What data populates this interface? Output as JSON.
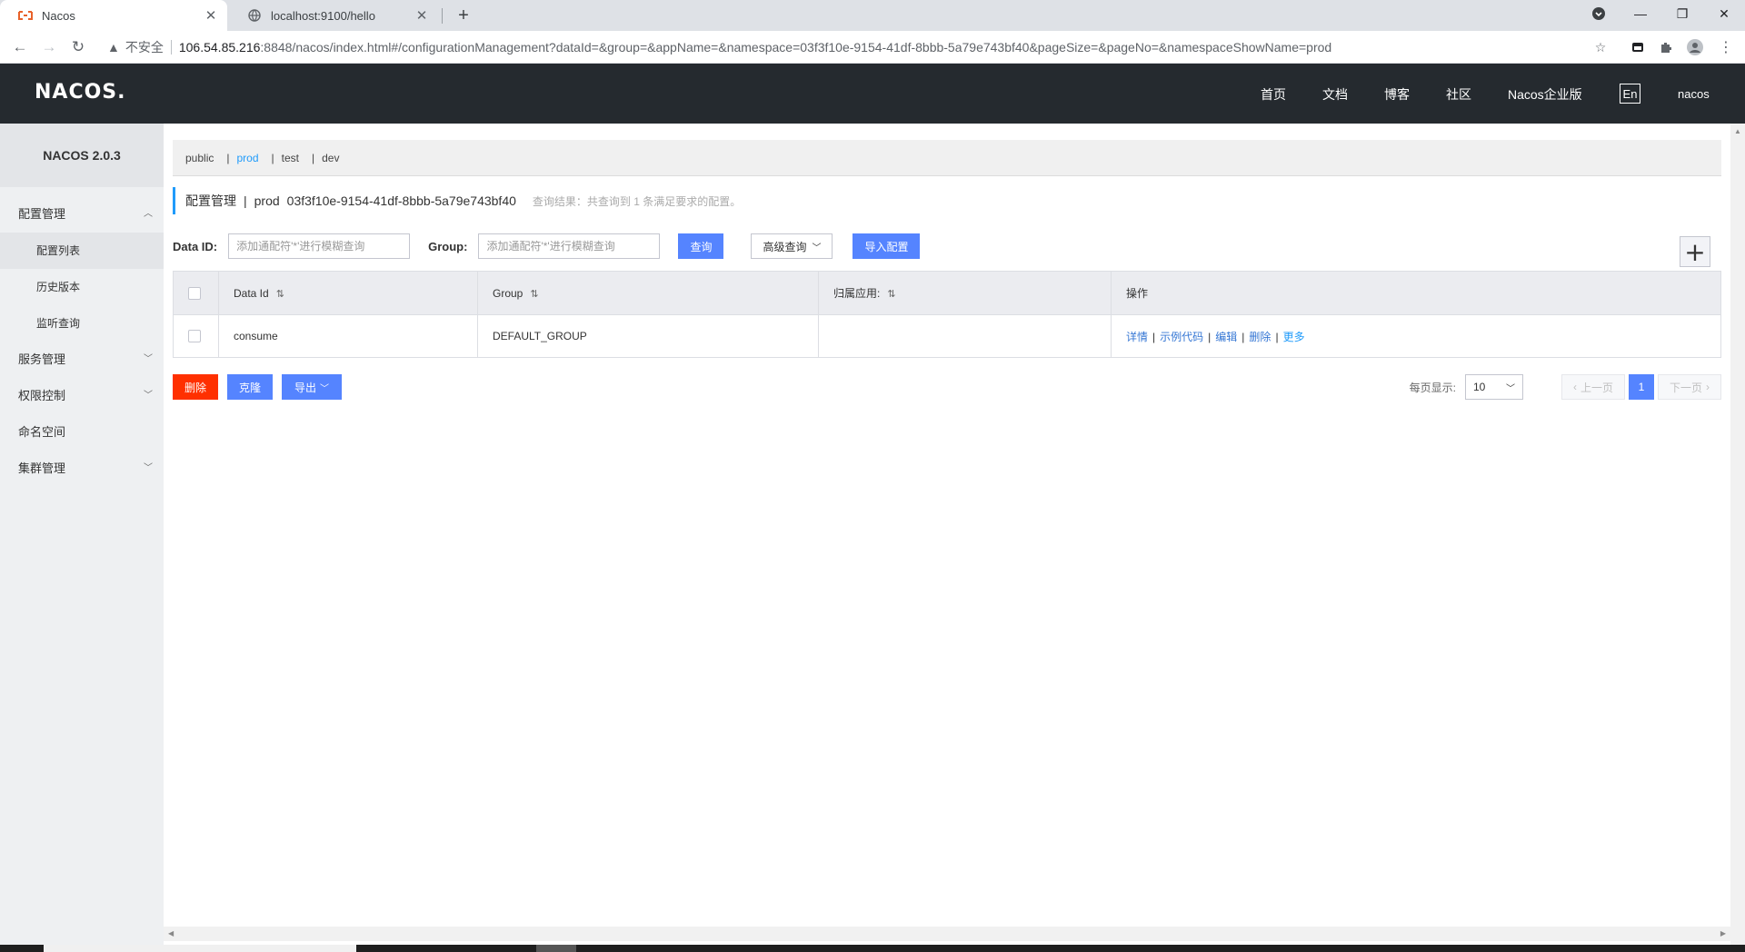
{
  "browser": {
    "tabs": [
      {
        "title": "Nacos",
        "active": true
      },
      {
        "title": "localhost:9100/hello",
        "active": false
      }
    ],
    "new_tab": "+",
    "window_controls": {
      "minimize": "—",
      "restore": "❐",
      "close": "✕"
    },
    "insecure_label": "不安全",
    "url_host": "106.54.85.216",
    "url_rest": ":8848/nacos/index.html#/configurationManagement?dataId=&group=&appName=&namespace=03f3f10e-9154-41df-8bbb-5a79e743bf40&pageSize=&pageNo=&namespaceShowName=prod",
    "icons": [
      "back-icon",
      "forward-icon",
      "reload-icon",
      "warning-icon",
      "star-icon",
      "extension-icon",
      "puzzle-icon",
      "profile-icon",
      "menu-icon"
    ]
  },
  "header": {
    "logo": "NACOS.",
    "nav": [
      "首页",
      "文档",
      "博客",
      "社区",
      "Nacos企业版"
    ],
    "lang": "En",
    "user": "nacos"
  },
  "sidebar": {
    "title": "NACOS 2.0.3",
    "groups": [
      {
        "label": "配置管理",
        "expanded": true,
        "items": [
          "配置列表",
          "历史版本",
          "监听查询"
        ]
      },
      {
        "label": "服务管理",
        "expanded": false
      },
      {
        "label": "权限控制",
        "expanded": false
      },
      {
        "label": "命名空间",
        "expanded": false
      },
      {
        "label": "集群管理",
        "expanded": false
      }
    ],
    "active_item": "配置列表"
  },
  "namespaces": [
    "public",
    "prod",
    "test",
    "dev"
  ],
  "active_namespace": "prod",
  "page": {
    "title": "配置管理",
    "namespace_name": "prod",
    "namespace_id": "03f3f10e-9154-41df-8bbb-5a79e743bf40",
    "hint": "查询结果：共查询到 1 条满足要求的配置。"
  },
  "filters": {
    "data_id_label": "Data ID:",
    "data_id_placeholder": "添加通配符'*'进行模糊查询",
    "group_label": "Group:",
    "group_placeholder": "添加通配符'*'进行模糊查询",
    "query_button": "查询",
    "advanced_button": "高级查询",
    "import_button": "导入配置",
    "add_button": "+"
  },
  "table": {
    "columns": [
      "Data Id",
      "Group",
      "归属应用:",
      "操作"
    ],
    "rows": [
      {
        "data_id": "consume",
        "group": "DEFAULT_GROUP",
        "app": "",
        "ops": [
          "详情",
          "示例代码",
          "编辑",
          "删除",
          "更多"
        ]
      }
    ]
  },
  "bulk_actions": {
    "delete": "删除",
    "clone": "克隆",
    "export": "导出"
  },
  "pagination": {
    "page_size_label": "每页显示:",
    "page_size": "10",
    "prev": "上一页",
    "current": "1",
    "next": "下一页"
  },
  "colors": {
    "header_bg": "#252a2f",
    "sidebar_bg": "#eef0f2",
    "primary": "#5584ff",
    "danger": "#ff3000",
    "link": "#3677d4",
    "accent": "#209bfa"
  }
}
